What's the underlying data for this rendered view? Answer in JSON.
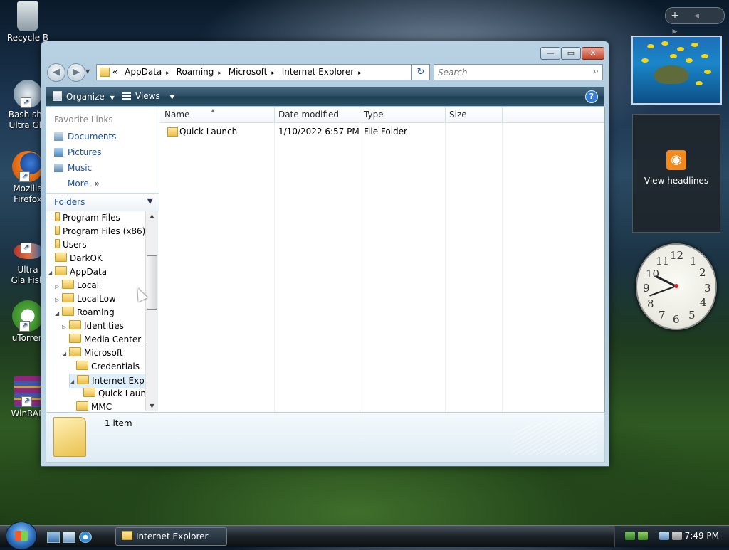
{
  "desktop": {
    "icons": [
      {
        "label": "Recycle B"
      },
      {
        "label": "Bash she Ultra Gla"
      },
      {
        "label": "Mozilla Firefox"
      },
      {
        "label": "Ultra Gla Fish"
      },
      {
        "label": "uTorren"
      },
      {
        "label": "WinRAR"
      }
    ]
  },
  "gadgets": {
    "sidebar_controls": [
      "+",
      "◂",
      "▸"
    ],
    "feed": {
      "label": "View headlines",
      "icon": "rss-icon"
    },
    "clock": {
      "numbers": [
        "12",
        "1",
        "2",
        "3",
        "4",
        "5",
        "6",
        "7",
        "8",
        "9",
        "10",
        "11"
      ],
      "time": "7:49"
    }
  },
  "window": {
    "caption_buttons": {
      "minimize": "—",
      "maximize": "▭",
      "close": "✕"
    },
    "nav": {
      "back": "◀",
      "forward": "▶"
    },
    "address": {
      "prefix": "«",
      "crumbs": [
        "AppData",
        "Roaming",
        "Microsoft",
        "Internet Explorer"
      ],
      "separator": "▸",
      "dropdown": "▼"
    },
    "refresh_icon": "↻",
    "search": {
      "placeholder": "Search",
      "value": ""
    },
    "toolbar": {
      "organize": "Organize",
      "views": "Views",
      "help": "?"
    },
    "favorite_links": {
      "title": "Favorite Links",
      "items": [
        "Documents",
        "Pictures",
        "Music",
        "More"
      ]
    },
    "folders_header": "Folders",
    "tree": [
      {
        "label": "Program Files",
        "arrow": ""
      },
      {
        "label": "Program Files (x86)",
        "arrow": ""
      },
      {
        "label": "Users",
        "arrow": ""
      },
      {
        "label": "DarkOK",
        "arrow": ""
      },
      {
        "label": "AppData",
        "arrow": "◢"
      },
      {
        "label": "Local",
        "arrow": "▷"
      },
      {
        "label": "LocalLow",
        "arrow": "▷"
      },
      {
        "label": "Roaming",
        "arrow": "◢"
      },
      {
        "label": "Identities",
        "arrow": "▷"
      },
      {
        "label": "Media Center Pr",
        "arrow": ""
      },
      {
        "label": "Microsoft",
        "arrow": "◢"
      },
      {
        "label": "Credentials",
        "arrow": ""
      },
      {
        "label": "Internet Explor",
        "arrow": "◢"
      },
      {
        "label": "Quick Launc",
        "arrow": ""
      },
      {
        "label": "MMC",
        "arrow": ""
      }
    ],
    "columns": [
      "Name",
      "Date modified",
      "Type",
      "Size"
    ],
    "rows": [
      {
        "name": "Quick Launch",
        "date": "1/10/2022 6:57 PM",
        "type": "File Folder",
        "size": ""
      }
    ],
    "details": {
      "count": "1 item"
    }
  },
  "taskbar": {
    "task_label": "Internet Explorer",
    "clock": "7:49 PM"
  }
}
